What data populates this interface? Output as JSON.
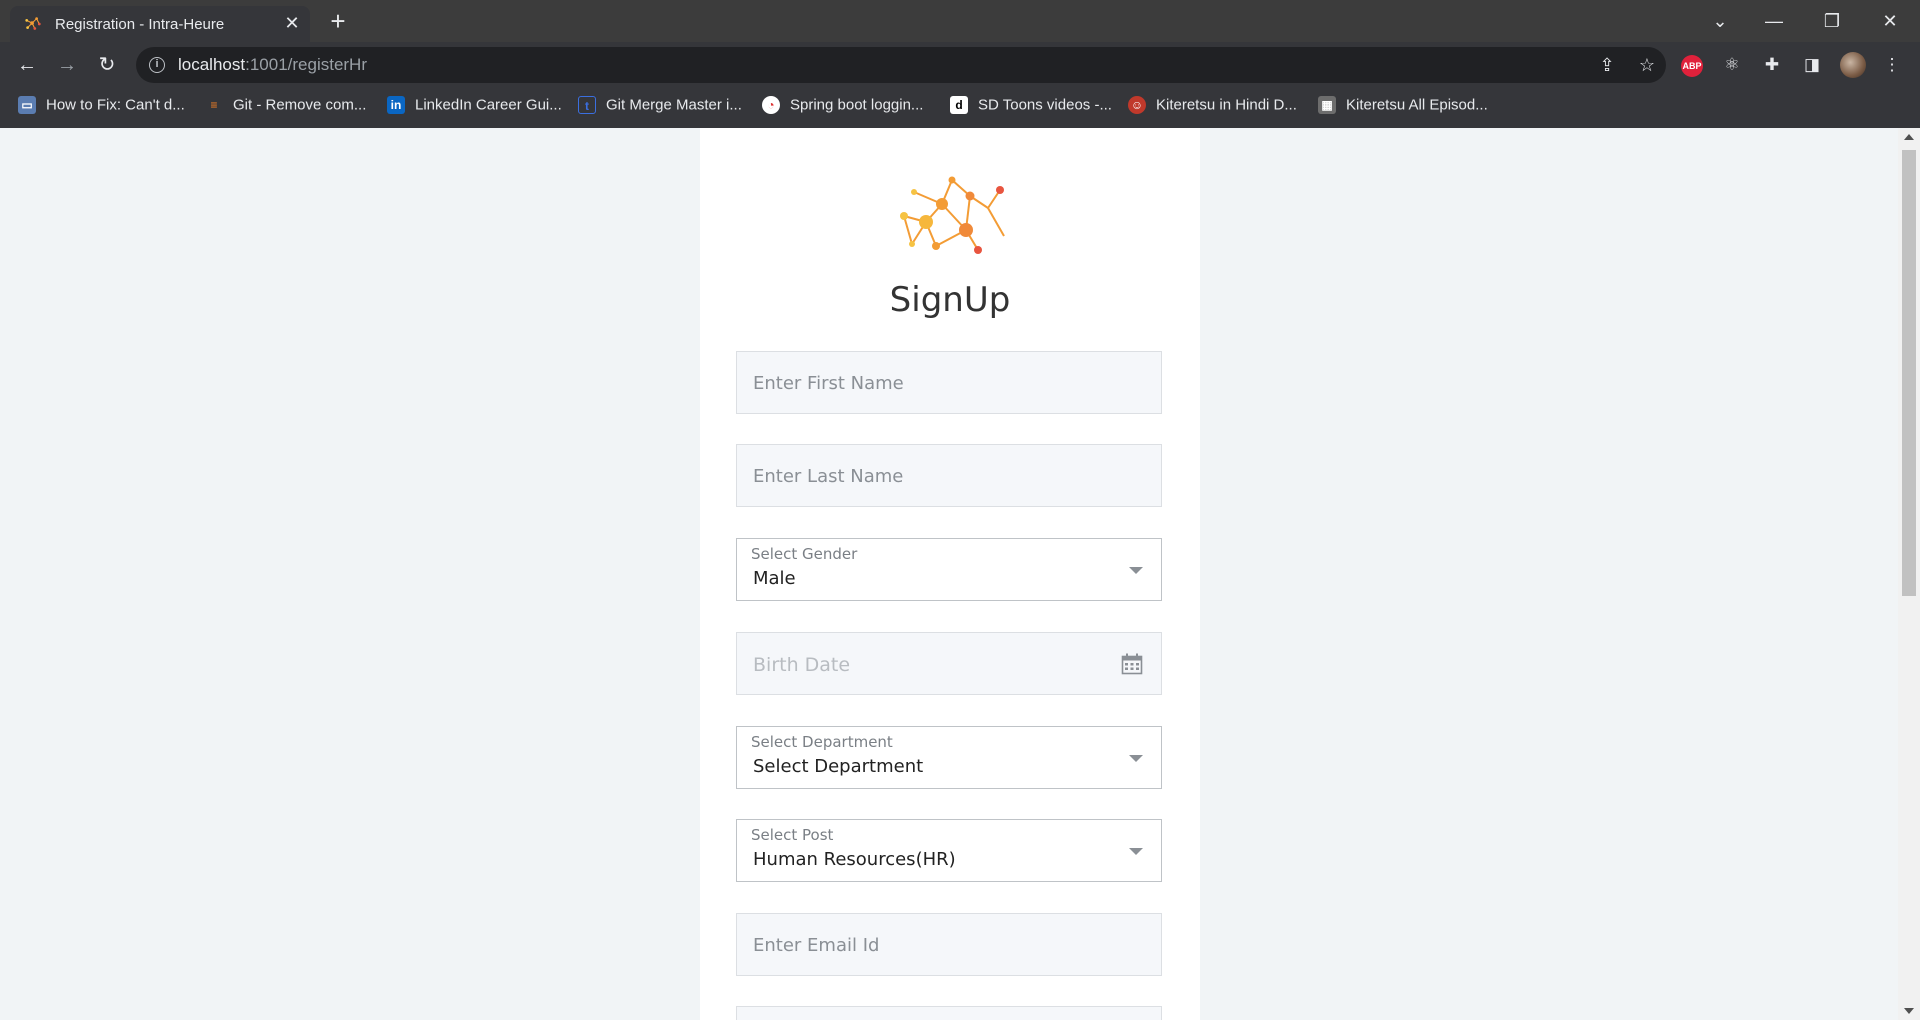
{
  "browser": {
    "tab_title": "Registration - Intra-Heure",
    "url_host": "localhost",
    "url_path": ":1001/registerHr",
    "bookmarks": [
      {
        "label": "How to Fix: Can't d...",
        "icon": "laptop-icon"
      },
      {
        "label": "Git - Remove com...",
        "icon": "stack-overflow-icon"
      },
      {
        "label": "LinkedIn Career Gui...",
        "icon": "linkedin-icon"
      },
      {
        "label": "Git Merge Master i...",
        "icon": "t-site-icon"
      },
      {
        "label": "Spring boot loggin...",
        "icon": "spring-icon"
      },
      {
        "label": "SD Toons videos -...",
        "icon": "dailymotion-icon"
      },
      {
        "label": "Kiteretsu in Hindi D...",
        "icon": "kiteretsu-icon"
      },
      {
        "label": "Kiteretsu All Episod...",
        "icon": "kiteretsu-grid-icon"
      }
    ],
    "extension_abp": "ABP"
  },
  "form": {
    "title": "SignUp",
    "first_name_placeholder": "Enter First Name",
    "last_name_placeholder": "Enter Last Name",
    "gender_label": "Select Gender",
    "gender_value": "Male",
    "birth_date_placeholder": "Birth Date",
    "department_label": "Select Department",
    "department_value": "Select Department",
    "post_label": "Select Post",
    "post_value": "Human Resources(HR)",
    "email_placeholder": "Enter Email Id"
  },
  "colors": {
    "logo_orange": "#f39c35",
    "logo_red": "#e8553f",
    "logo_yellow": "#f6c343"
  }
}
